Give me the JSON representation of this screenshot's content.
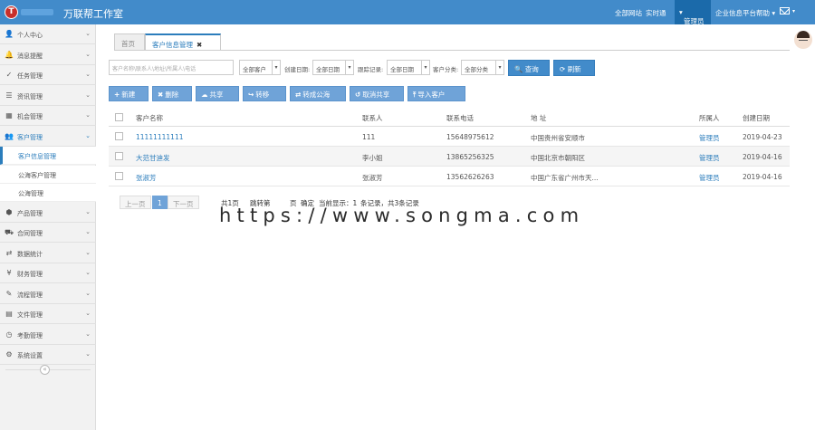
{
  "app": {
    "logo_letter": "T",
    "title": "万联帮工作室"
  },
  "topnav": {
    "items": [
      "全部网站",
      "实时通",
      "管理员",
      "企业信息平台帮助"
    ],
    "active": "管理员"
  },
  "sidebar": {
    "items": [
      {
        "icon": "user-icon",
        "glyph": "👤",
        "label": "个人中心"
      },
      {
        "icon": "bell-icon",
        "glyph": "🔔",
        "label": "消息提醒"
      },
      {
        "icon": "check-circle-icon",
        "glyph": "✓",
        "label": "任务管理"
      },
      {
        "icon": "list-icon",
        "glyph": "☰",
        "label": "资讯管理"
      },
      {
        "icon": "grid-icon",
        "glyph": "▦",
        "label": "机会管理"
      },
      {
        "icon": "users-icon",
        "glyph": "👥",
        "label": "客户管理"
      },
      {
        "icon": "handshake-icon",
        "glyph": "⬢",
        "label": "产品管理"
      },
      {
        "icon": "truck-icon",
        "glyph": "⛟",
        "label": "合同管理"
      },
      {
        "icon": "shuffle-icon",
        "glyph": "⇄",
        "label": "数据统计"
      },
      {
        "icon": "yen-icon",
        "glyph": "¥",
        "label": "财务管理"
      },
      {
        "icon": "edit-icon",
        "glyph": "✎",
        "label": "流程管理"
      },
      {
        "icon": "file-icon",
        "glyph": "▤",
        "label": "文件管理"
      },
      {
        "icon": "clock-icon",
        "glyph": "◷",
        "label": "考勤管理"
      },
      {
        "icon": "gear-icon",
        "glyph": "⚙",
        "label": "系统设置"
      }
    ],
    "sub_items": [
      "客户信息管理",
      "公海客户管理",
      "公海管理"
    ]
  },
  "tabs": [
    {
      "label": "首页"
    },
    {
      "label": "客户信息管理",
      "close": "✖"
    }
  ],
  "filters": {
    "search_placeholder": "客户名称\\联系人\\地址\\所属人\\电话",
    "customer_select": "全部客户",
    "create_date_label": "创建日期:",
    "create_date_select": "全部日期",
    "followup_label": "跟踪记录:",
    "followup_select": "全部日期",
    "category_label": "客户分类:",
    "category_select": "全部分类",
    "query_btn": "查询",
    "refresh_btn": "刷新"
  },
  "actions": [
    "新建",
    "删除",
    "共享",
    "转移",
    "转成公海",
    "取消共享",
    "导入客户"
  ],
  "table": {
    "headers": [
      "客户名称",
      "联系人",
      "联系电话",
      "地 址",
      "所属人",
      "创建日期"
    ],
    "rows": [
      [
        "11111111111",
        "111",
        "15648975612",
        "中国贵州省安顺市",
        "管理员",
        "2019-04-23"
      ],
      [
        "大范甘迪发",
        "李小姐",
        "13865256325",
        "中国北京市朝阳区",
        "管理员",
        "2019-04-16"
      ],
      [
        "张淑芳",
        "张淑芳",
        "13562626263",
        "中国广东省广州市天...",
        "管理员",
        "2019-04-16"
      ]
    ]
  },
  "pagination": {
    "prev": "上一页",
    "current": "1",
    "next": "下一页",
    "total_pages": "共1页",
    "jump_label": "跳转第",
    "jump_unit": "页",
    "confirm": "确定",
    "current_display": "当前显示：1",
    "records_suffix": "条记录，共3条记录"
  },
  "watermark": "https://www.songma.com"
}
